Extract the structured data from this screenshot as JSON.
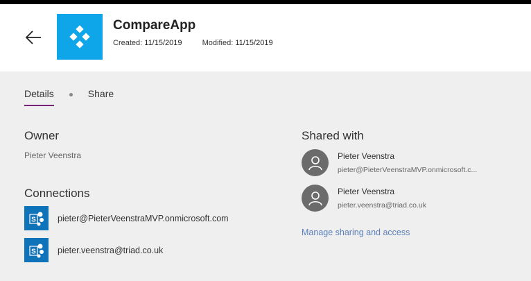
{
  "header": {
    "app_name": "CompareApp",
    "created_label": "Created:",
    "created_value": "11/15/2019",
    "modified_label": "Modified:",
    "modified_value": "11/15/2019"
  },
  "tabs": [
    {
      "label": "Details",
      "active": true
    },
    {
      "label": "Share",
      "active": false
    }
  ],
  "owner": {
    "heading": "Owner",
    "name": "Pieter Veenstra"
  },
  "connections": {
    "heading": "Connections",
    "items": [
      {
        "label": "pieter@PieterVeenstraMVP.onmicrosoft.com",
        "icon": "sharepoint-icon"
      },
      {
        "label": "pieter.veenstra@triad.co.uk",
        "icon": "sharepoint-icon"
      }
    ]
  },
  "shared_with": {
    "heading": "Shared with",
    "people": [
      {
        "name": "Pieter Veenstra",
        "email": "pieter@PieterVeenstraMVP.onmicrosoft.c..."
      },
      {
        "name": "Pieter Veenstra",
        "email": "pieter.veenstra@triad.co.uk"
      }
    ],
    "manage_link": "Manage sharing and access"
  },
  "colors": {
    "app_tile": "#0ea5e9",
    "tab_underline": "#742774",
    "sharepoint": "#0f73b9",
    "link": "#5b7fb8"
  }
}
